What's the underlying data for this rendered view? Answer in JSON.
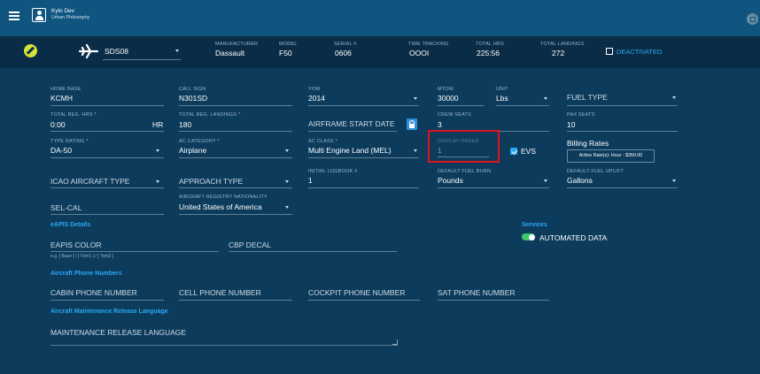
{
  "user": {
    "name": "Kylo Dev",
    "org": "Urban Philosophy"
  },
  "aircraft": {
    "tail": "SDS08",
    "manufacturer_label": "MANUFACTURER",
    "manufacturer": "Dassault",
    "model_label": "MODEL",
    "model": "F50",
    "serial_label": "SERIAL #",
    "serial": "0606",
    "time_tracking_label": "TIME TRACKING",
    "time_tracking": "OOOI",
    "total_hrs_label": "TOTAL HRS",
    "total_hrs": "225:56",
    "total_landings_label": "TOTAL LANDINGS",
    "total_landings": "272",
    "deactivated_label": "DEACTIVATED"
  },
  "form": {
    "home_base": {
      "label": "HOME BASE",
      "value": "KCMH"
    },
    "call_sign": {
      "label": "CALL SIGN",
      "value": "N301SD"
    },
    "yom": {
      "label": "YOM",
      "value": "2014"
    },
    "mtow": {
      "label": "MTOW",
      "value": "30000"
    },
    "unit": {
      "label": "UNIT",
      "value": "Lbs"
    },
    "fuel_type": {
      "placeholder": "FUEL TYPE"
    },
    "total_beg_hrs": {
      "label": "TOTAL BEG. HRS *",
      "value": "0:00",
      "suffix": "HR"
    },
    "total_beg_landings": {
      "label": "TOTAL BEG. LANDINGS *",
      "value": "180"
    },
    "airframe_start_date": {
      "placeholder": "AIRFRAME START DATE"
    },
    "crew_seats": {
      "label": "CREW SEATS",
      "value": "3"
    },
    "pax_seats": {
      "label": "PAX SEATS",
      "value": "10"
    },
    "type_rating": {
      "label": "TYPE RATING *",
      "value": "DA-50"
    },
    "ac_category": {
      "label": "AC CATEGORY *",
      "value": "Airplane"
    },
    "ac_class": {
      "label": "AC CLASS *",
      "value": "Multi Engine Land (MEL)"
    },
    "display_order": {
      "label": "DISPLAY ORDER",
      "value": "1"
    },
    "evs": {
      "label": "EVS"
    },
    "billing": {
      "label": "Billing Rates",
      "button": "Active Rate(s): Hour - $350.00"
    },
    "icao_type": {
      "placeholder": "ICAO AIRCRAFT TYPE"
    },
    "approach_type": {
      "placeholder": "APPROACH TYPE"
    },
    "initial_logbook": {
      "label": "INITIAL LOGBOOK #",
      "value": "1"
    },
    "default_fuel_burn": {
      "label": "DEFAULT FUEL BURN",
      "value": "Pounds"
    },
    "default_fuel_uplift": {
      "label": "DEFAULT FUEL UPLIFT",
      "value": "Gallons"
    },
    "registry_nationality": {
      "label": "AIRCRAFT REGISTRY NATIONALITY",
      "value": "United States of America"
    },
    "selcal": {
      "placeholder": "SEL-CAL"
    },
    "eapis_section": "eAPIS Details",
    "eapis_color": {
      "placeholder": "EAPIS COLOR",
      "hint": "e.g. [ Base ] / [ Trim1 ] / [ Trim2 ]"
    },
    "cbp_decal": {
      "placeholder": "CBP DECAL"
    },
    "services_section": "Services",
    "automated_data": {
      "label": "AUTOMATED DATA"
    },
    "phone_section": "Aircraft Phone Numbers",
    "cabin_phone": {
      "placeholder": "CABIN PHONE NUMBER"
    },
    "cell_phone": {
      "placeholder": "CELL PHONE NUMBER"
    },
    "cockpit_phone": {
      "placeholder": "COCKPIT PHONE NUMBER"
    },
    "sat_phone": {
      "placeholder": "SAT PHONE NUMBER"
    },
    "maintenance_section": "Aircraft Maintenance Release Language",
    "maintenance_release": {
      "placeholder": "MAINTENANCE RELEASE LANGUAGE"
    }
  },
  "colors": {
    "background": "#0c3b5c",
    "topbar": "#0f5580",
    "accent": "#2aa9f5",
    "highlight": "#e0121b",
    "toggle": "#3cc86a",
    "edit_icon": "#d7e33b"
  }
}
